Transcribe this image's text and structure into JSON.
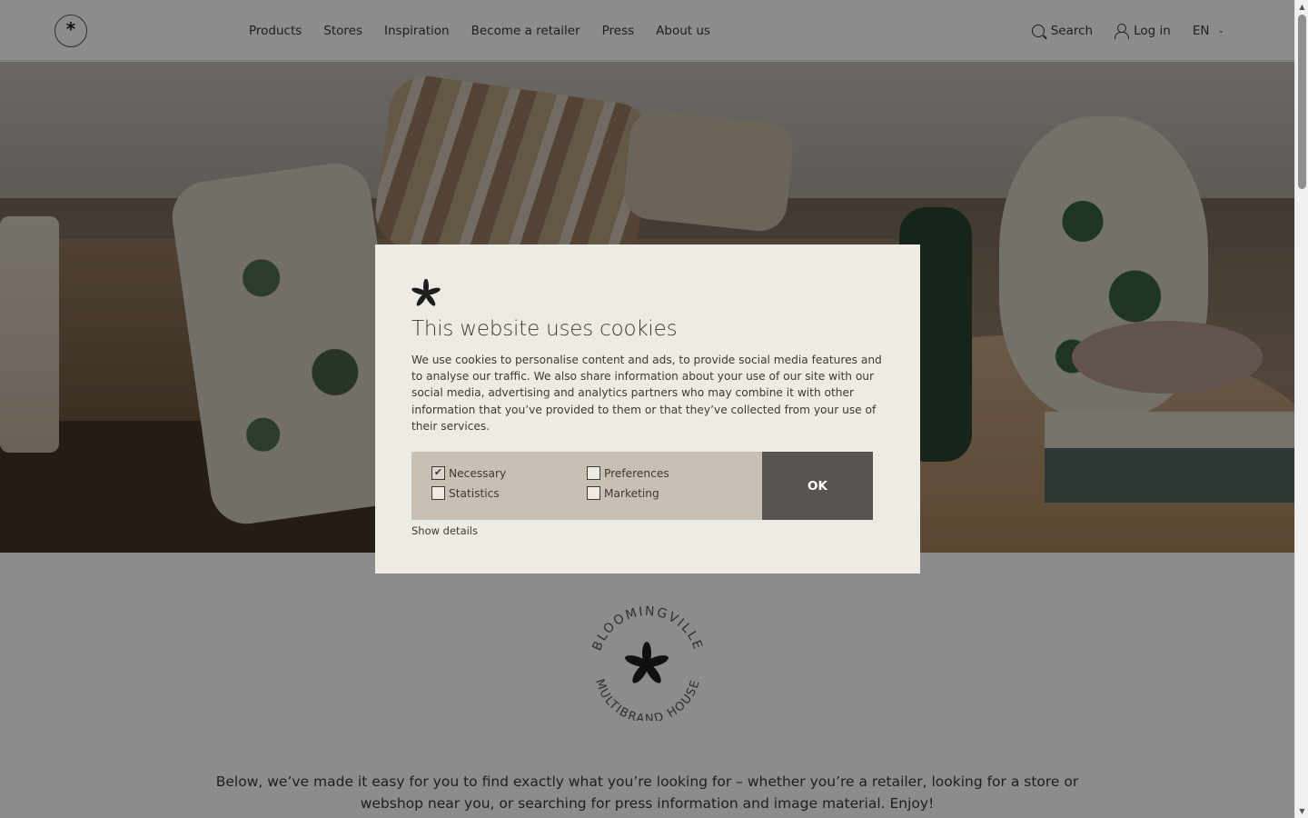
{
  "header": {
    "logo_name": "bloomingville-logo",
    "nav": [
      "Products",
      "Stores",
      "Inspiration",
      "Become a retailer",
      "Press",
      "About us"
    ],
    "search_label": "Search",
    "login_label": "Log in",
    "language": "EN"
  },
  "intro": {
    "text": "Below, we’ve made it easy for you to find exactly what you’re looking for – whether you’re a retailer, looking for a store or webshop near you, or searching for press information and image material. Enjoy!"
  },
  "badge": {
    "top_text": "BLOOMINGVILLE",
    "bottom_text": "MULTIBRAND HOUSE"
  },
  "cookie": {
    "title": "This website uses cookies",
    "text": "We use cookies to personalise content and ads, to provide social media features and to analyse our traffic. We also share information about your use of our site with our social media, advertising and analytics partners who may combine it with other information that you’ve provided to them or that they’ve collected from your use of their services.",
    "options": {
      "necessary": {
        "label": "Necessary",
        "checked": true
      },
      "preferences": {
        "label": "Preferences",
        "checked": false
      },
      "statistics": {
        "label": "Statistics",
        "checked": false
      },
      "marketing": {
        "label": "Marketing",
        "checked": false
      }
    },
    "ok_label": "OK",
    "details_label": "Show details"
  },
  "colors": {
    "dialog_bg": "#eeebe4",
    "panel_bg": "#c8bfb5",
    "ok_bg": "#58544f",
    "text": "#3d3a35"
  }
}
